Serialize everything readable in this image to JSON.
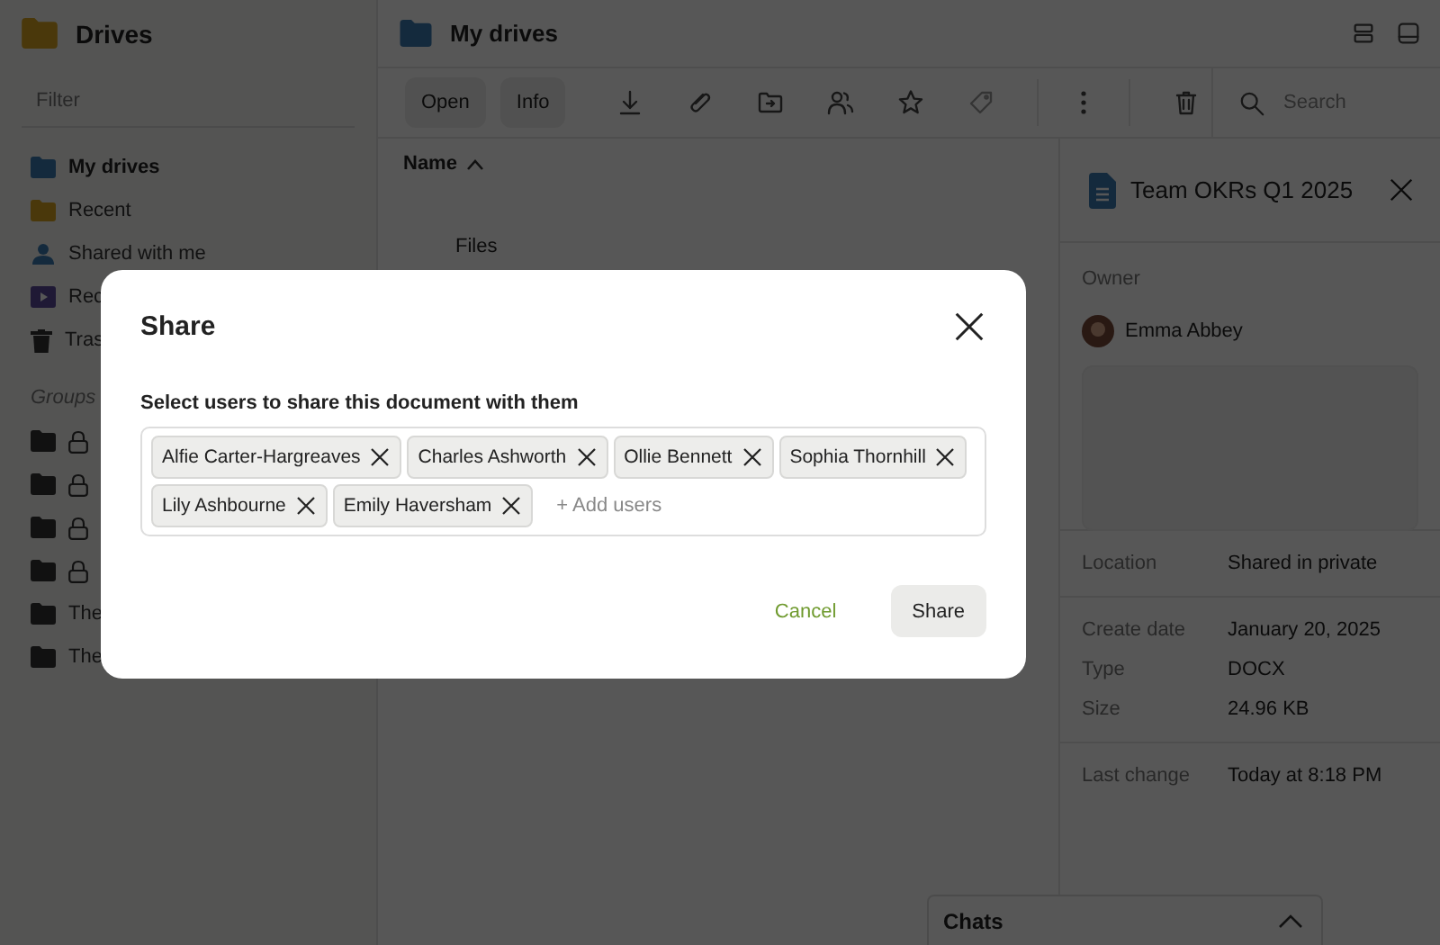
{
  "sidebar": {
    "title": "Drives",
    "filter": {
      "placeholder": "Filter"
    },
    "items": [
      {
        "label": "My drives",
        "kind": "drive",
        "selected": true
      },
      {
        "label": "Recent",
        "kind": "recent",
        "selected": false
      },
      {
        "label": "Shared with me",
        "kind": "shared",
        "selected": false
      },
      {
        "label": "Rec",
        "kind": "recordings",
        "selected": false
      },
      {
        "label": "Tras",
        "kind": "trash",
        "selected": false
      }
    ],
    "groups_label": "Groups",
    "groups": [
      {
        "locked": true
      },
      {
        "locked": true
      },
      {
        "locked": true
      },
      {
        "locked": true
      },
      {
        "label": "The",
        "locked": false
      },
      {
        "label": "The",
        "locked": false
      }
    ]
  },
  "main": {
    "title": "My drives",
    "toolbar": {
      "buttons": [
        "Open",
        "Info"
      ]
    },
    "search": {
      "placeholder": "Search"
    },
    "column": "Name",
    "sort_ascending": true,
    "section": "Files"
  },
  "details": {
    "title": "Team OKRs Q1 2025",
    "owner_label": "Owner",
    "owner": "Emma Abbey",
    "sections": [
      [
        {
          "label": "Location",
          "value": "Shared in private"
        }
      ],
      [
        {
          "label": "Create date",
          "value": "January 20, 2025"
        },
        {
          "label": "Type",
          "value": "DOCX"
        },
        {
          "label": "Size",
          "value": "24.96 KB"
        }
      ],
      [
        {
          "label": "Last change",
          "value": "Today at 8:18 PM"
        }
      ]
    ]
  },
  "chats": {
    "title": "Chats",
    "expanded": false
  },
  "dialog": {
    "title": "Share",
    "prompt": "Select users to share this document with them",
    "users": [
      "Alfie Carter-Hargreaves",
      "Charles Ashworth",
      "Ollie Bennett",
      "Sophia Thornhill",
      "Lily Ashbourne",
      "Emily Haversham"
    ],
    "add": {
      "placeholder": "+ Add users"
    },
    "cancel": "Cancel",
    "confirm": "Share"
  }
}
